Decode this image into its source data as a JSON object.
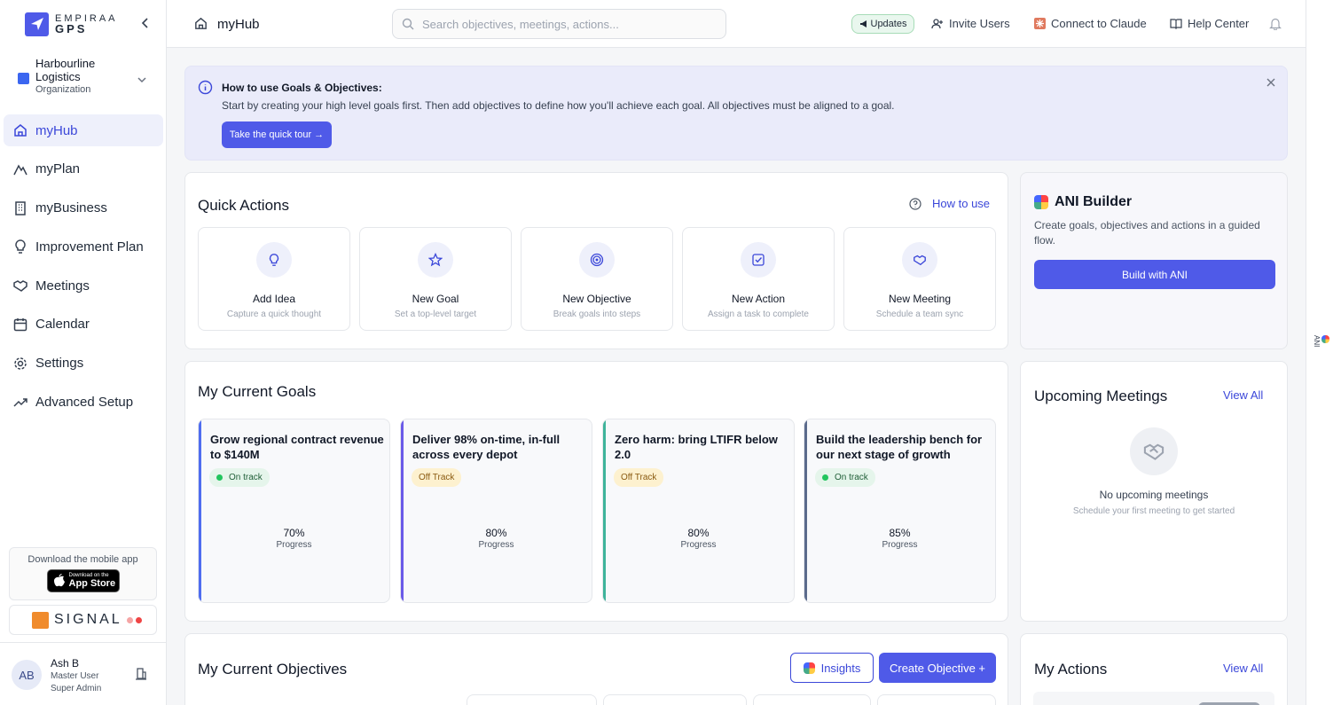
{
  "brand": {
    "logo_line1": "EMPIRAA",
    "logo_line2": "GPS"
  },
  "org": {
    "name": "Harbourline Logistics",
    "type": "Organization"
  },
  "nav": [
    {
      "label": "myHub",
      "icon": "home-icon",
      "active": true
    },
    {
      "label": "myPlan",
      "icon": "mountain-icon"
    },
    {
      "label": "myBusiness",
      "icon": "building-icon"
    },
    {
      "label": "Improvement Plan",
      "icon": "lightbulb-icon"
    },
    {
      "label": "Meetings",
      "icon": "handshake-icon"
    },
    {
      "label": "Calendar",
      "icon": "calendar-icon"
    },
    {
      "label": "Settings",
      "icon": "gear-icon"
    },
    {
      "label": "Advanced Setup",
      "icon": "trend-icon"
    }
  ],
  "mobile_app": {
    "text": "Download the mobile app",
    "badge_small": "Download on the",
    "badge_large": "App Store"
  },
  "signal": {
    "label": "SIGNAL"
  },
  "user": {
    "initials": "AB",
    "name": "Ash B",
    "role1": "Master User",
    "role2": "Super Admin"
  },
  "topbar": {
    "title": "myHub",
    "search_placeholder": "Search objectives, meetings, actions...",
    "updates": "Updates",
    "invite": "Invite Users",
    "connect": "Connect to Claude",
    "help": "Help Center"
  },
  "right_tab": {
    "label": "ANI"
  },
  "banner": {
    "title": "How to use Goals & Objectives:",
    "text": "Start by creating your high level goals first. Then add objectives to define how you'll achieve each goal. All objectives must be aligned to a goal.",
    "button": "Take the quick tour →"
  },
  "quick_actions": {
    "title": "Quick Actions",
    "how_to": "How to use",
    "items": [
      {
        "label": "Add Idea",
        "desc": "Capture a quick thought",
        "icon": "lightbulb-icon"
      },
      {
        "label": "New Goal",
        "desc": "Set a top-level target",
        "icon": "star-icon"
      },
      {
        "label": "New Objective",
        "desc": "Break goals into steps",
        "icon": "target-icon"
      },
      {
        "label": "New Action",
        "desc": "Assign a task to complete",
        "icon": "check-square-icon"
      },
      {
        "label": "New Meeting",
        "desc": "Schedule a team sync",
        "icon": "handshake-icon"
      }
    ]
  },
  "ani_builder": {
    "title": "ANI Builder",
    "desc": "Create goals, objectives and actions in a guided flow.",
    "button": "Build with ANI"
  },
  "goals": {
    "title": "My Current Goals",
    "items": [
      {
        "title": "Grow regional contract revenue to $140M",
        "status": "On track",
        "status_kind": "on",
        "progress": "70%",
        "progress_label": "Progress",
        "color": "#4f6df0"
      },
      {
        "title": "Deliver 98% on-time, in-full across every depot",
        "status": "Off Track",
        "status_kind": "off",
        "progress": "80%",
        "progress_label": "Progress",
        "color": "#6a5ae8"
      },
      {
        "title": "Zero harm: bring LTIFR below 2.0",
        "status": "Off Track",
        "status_kind": "off",
        "progress": "80%",
        "progress_label": "Progress",
        "color": "#3fb39a"
      },
      {
        "title": "Build the leadership bench for our next stage of growth",
        "status": "On track",
        "status_kind": "on",
        "progress": "85%",
        "progress_label": "Progress",
        "color": "#5b6b8c"
      }
    ]
  },
  "meetings": {
    "title": "Upcoming Meetings",
    "view_all": "View All",
    "empty_title": "No upcoming meetings",
    "empty_sub": "Schedule your first meeting to get started"
  },
  "objectives": {
    "title": "My Current Objectives",
    "insights": "Insights",
    "create": "Create Objective +"
  },
  "actions": {
    "title": "My Actions",
    "view_all": "View All"
  }
}
